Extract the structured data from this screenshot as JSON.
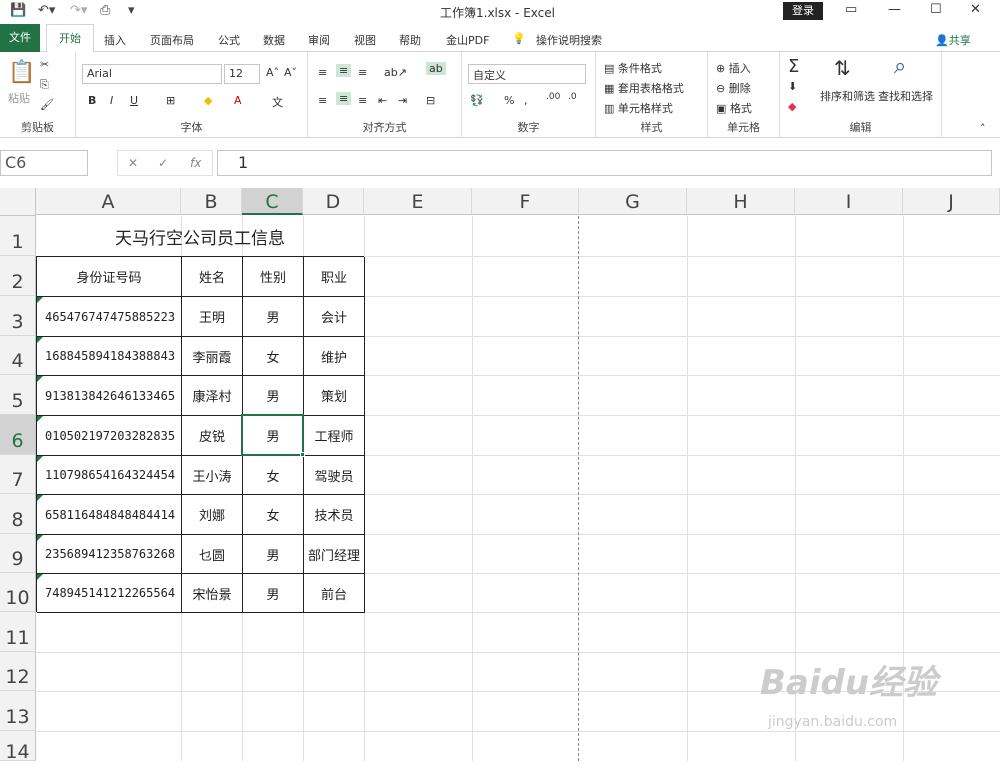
{
  "window": {
    "title": "工作簿1.xlsx  -  Excel",
    "login_label": "登录"
  },
  "tabs": [
    "文件",
    "开始",
    "插入",
    "页面布局",
    "公式",
    "数据",
    "审阅",
    "视图",
    "帮助",
    "金山PDF",
    "操作说明搜索"
  ],
  "share_label": "共享",
  "ribbon": {
    "clipboard": {
      "label": "剪贴板",
      "paste": "粘贴"
    },
    "font": {
      "label": "字体",
      "name": "Arial",
      "size": "12"
    },
    "align": {
      "label": "对齐方式"
    },
    "number": {
      "label": "数字",
      "format": "自定义"
    },
    "styles": {
      "label": "样式",
      "cond": "条件格式",
      "table": "套用表格格式",
      "cell": "单元格样式"
    },
    "cells": {
      "label": "单元格",
      "insert": "插入",
      "delete": "删除",
      "format": "格式"
    },
    "editing": {
      "label": "编辑",
      "sort": "排序和筛选",
      "find": "查找和选择"
    }
  },
  "formula_bar": {
    "name_box": "C6",
    "fx": "fx",
    "value": "1"
  },
  "columns": [
    "A",
    "B",
    "C",
    "D",
    "E",
    "F",
    "G",
    "H",
    "I",
    "J"
  ],
  "rows": [
    "1",
    "2",
    "3",
    "4",
    "5",
    "6",
    "7",
    "8",
    "9",
    "10",
    "11",
    "12",
    "13",
    "14"
  ],
  "sheet": {
    "title": "天马行空公司员工信息",
    "headers": [
      "身份证号码",
      "姓名",
      "性别",
      "职业"
    ],
    "records": [
      [
        "465476747475885223",
        "王明",
        "男",
        "会计"
      ],
      [
        "168845894184388843",
        "李丽霞",
        "女",
        "维护"
      ],
      [
        "913813842646133465",
        "康泽村",
        "男",
        "策划"
      ],
      [
        "010502197203282835",
        "皮锐",
        "男",
        "工程师"
      ],
      [
        "110798654164324454",
        "王小涛",
        "女",
        "驾驶员"
      ],
      [
        "658116484848484414",
        "刘娜",
        "女",
        "技术员"
      ],
      [
        "235689412358763268",
        "乜圆",
        "男",
        "部门经理"
      ],
      [
        "748945141212265564",
        "宋怡景",
        "男",
        "前台"
      ]
    ]
  },
  "watermark": {
    "logo": "Baidu经验",
    "url": "jingyan.baidu.com"
  }
}
